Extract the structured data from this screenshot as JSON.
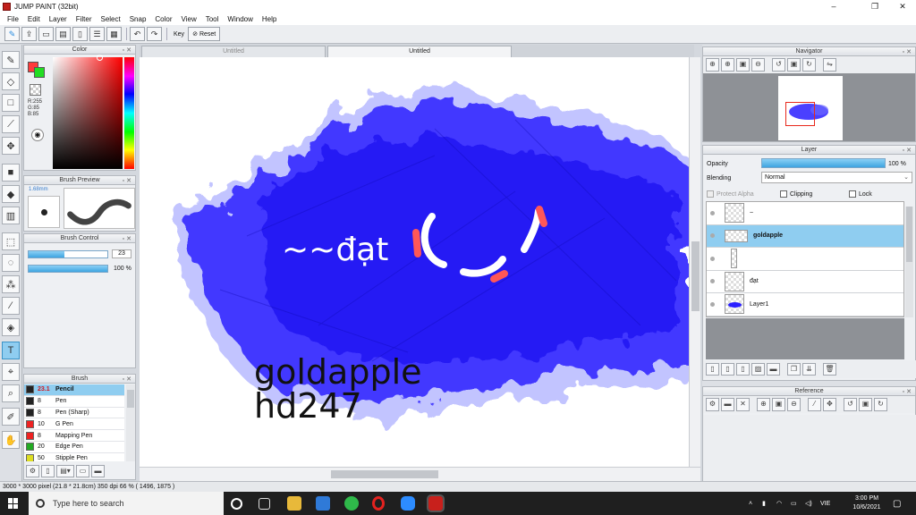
{
  "window": {
    "title": "JUMP PAINT (32bit)",
    "controls": [
      "–",
      "❐",
      "✕"
    ]
  },
  "menu": [
    "File",
    "Edit",
    "Layer",
    "Filter",
    "Select",
    "Snap",
    "Color",
    "View",
    "Tool",
    "Window",
    "Help"
  ],
  "toolbar": {
    "key_label": "Key",
    "reset_label": "Reset"
  },
  "panels": {
    "color": "Color",
    "brush_preview": "Brush Preview",
    "brush_control": "Brush Control",
    "brush": "Brush",
    "navigator": "Navigator",
    "layer": "Layer",
    "reference": "Reference"
  },
  "color": {
    "fg": "#ff3b3b",
    "bg": "#22dd22",
    "r": "R:255",
    "g": "G:85",
    "b": "B:85"
  },
  "brush_preview": {
    "size": "1.68mm"
  },
  "brush_control": {
    "size": "23",
    "opacity": "100 %",
    "size_level": 0.45,
    "opacity_level": 1.0
  },
  "brushes": [
    {
      "num": "23.1",
      "name": "Pencil",
      "color": "#222222",
      "selected": true
    },
    {
      "num": "8",
      "name": "Pen",
      "color": "#222222"
    },
    {
      "num": "8",
      "name": "Pen (Sharp)",
      "color": "#222222"
    },
    {
      "num": "10",
      "name": "G Pen",
      "color": "#ee2222"
    },
    {
      "num": "8",
      "name": "Mapping Pen",
      "color": "#ee2222"
    },
    {
      "num": "20",
      "name": "Edge Pen",
      "color": "#22aa22"
    },
    {
      "num": "50",
      "name": "Stipple Pen",
      "color": "#dddd22"
    }
  ],
  "tabs": [
    "Untitled",
    "Untitled"
  ],
  "canvas": {
    "text1": "~~đạt",
    "text2": "goldapple",
    "text3": "hd247",
    "paint_color": "#2a1fff"
  },
  "layer": {
    "opacity_label": "Opacity",
    "opacity_value": "100 %",
    "blending_label": "Blending",
    "blending_value": "Normal",
    "protect_alpha": "Protect Alpha",
    "clipping": "Clipping",
    "lock": "Lock",
    "layers": [
      {
        "name": "~",
        "selected": false
      },
      {
        "name": "goldapple",
        "selected": true
      },
      {
        "name": "",
        "selected": false
      },
      {
        "name": "đạt",
        "selected": false
      },
      {
        "name": "Layer1",
        "selected": false
      }
    ]
  },
  "status": "3000 * 3000 pixel   (21.8 * 21.8cm)   350 dpi   66 %   ( 1496, 1875 )",
  "taskbar": {
    "search_placeholder": "Type here to search",
    "lang": "VIE",
    "time": "3:00 PM",
    "date": "10/6/2021"
  }
}
